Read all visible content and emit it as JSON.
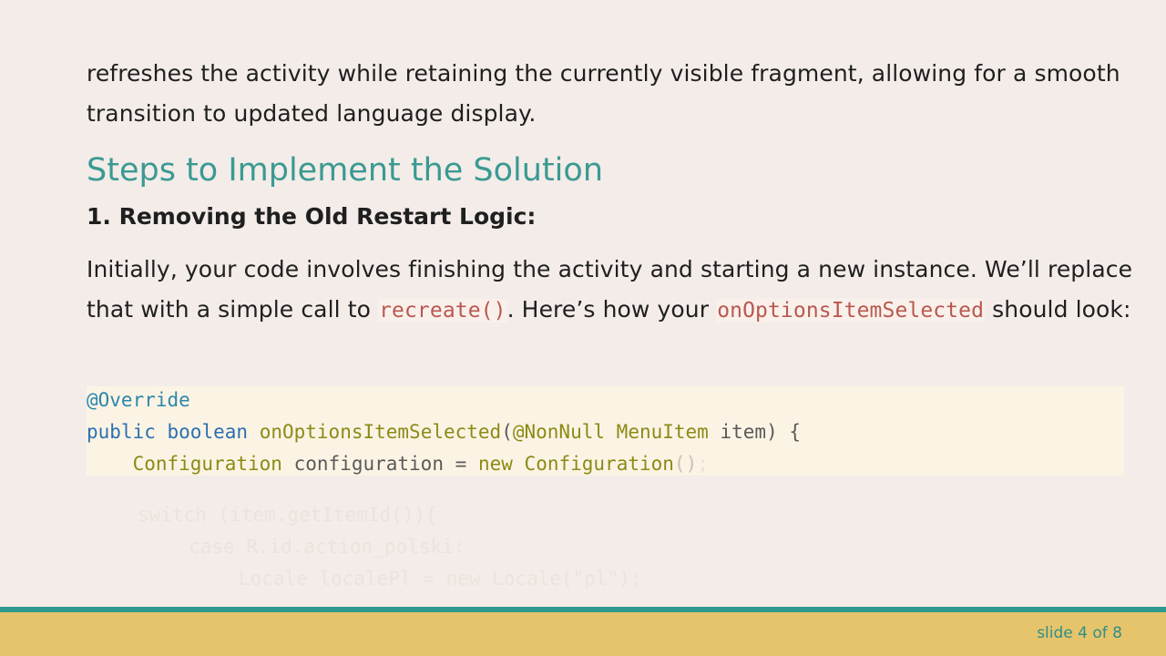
{
  "intro": {
    "text": "refreshes the activity while retaining the currently visible fragment, allowing for a smooth transition to updated language display."
  },
  "heading": "Steps to Implement the Solution",
  "step1": {
    "title": "1. Removing the Old Restart Logic:",
    "text_part1": "Initially, your code involves finishing the activity and starting a new instance. We’ll replace that with a simple call to ",
    "code1": "recreate()",
    "text_part2": ". Here’s how your ",
    "code2": "onOptionsItemSelected",
    "text_part3": " should look:"
  },
  "code": {
    "line1": "@Override",
    "line2_kw_public": "public",
    "line2_kw_boolean": "boolean",
    "line2_method": "onOptionsItemSelected",
    "line2_paren_open": "(",
    "line2_annot": "@NonNull",
    "line2_type": "MenuItem",
    "line2_param": "item",
    "line2_close": ") {",
    "line3_type": "Configuration",
    "line3_var": "configuration",
    "line3_eq": "=",
    "line3_new": "new",
    "line3_ctor": "Configuration",
    "line3_parens": "()",
    "line3_semi": ";",
    "faded_line1": "switch (item.getItemId()){",
    "faded_line2": "case R.id.action_polski:",
    "faded_line3": "Locale localePl = new Locale(\"pl\");"
  },
  "footer": {
    "slide_number": "slide 4 of 8"
  },
  "colors": {
    "background": "#f3ece8",
    "heading": "#3a9a92",
    "inline_code": "#b8594f",
    "code_background": "#fbf4e4",
    "footer_bar": "#e6c46b",
    "footer_line": "#2e9a8e"
  }
}
